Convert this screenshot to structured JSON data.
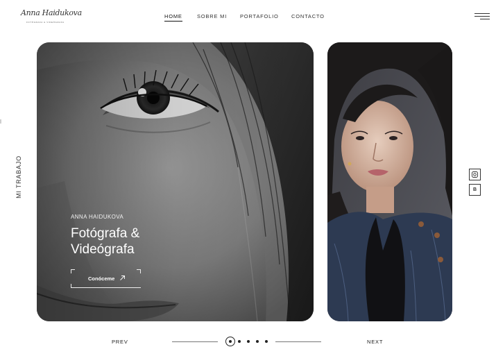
{
  "header": {
    "logo_script": "Anna Haidukova",
    "logo_sub": "FOTÓGRAFA & VIDEÓGRAFA"
  },
  "nav": {
    "items": [
      {
        "label": "HOME",
        "active": true
      },
      {
        "label": "SOBRE MI",
        "active": false
      },
      {
        "label": "PORTAFOLIO",
        "active": false
      },
      {
        "label": "CONTACTO",
        "active": false
      }
    ]
  },
  "side": {
    "label": "MI TRABAJO"
  },
  "hero": {
    "eyebrow": "ANNA HAIDUKOVA",
    "title_line1": "Fotógrafa &",
    "title_line2": "Videógrafa",
    "button_label": "Conóceme",
    "button_icon": "arrow-up-right-icon"
  },
  "social": {
    "instagram_icon": "instagram-icon",
    "behance_text": "B"
  },
  "pager": {
    "prev": "PREV",
    "next": "NEXT",
    "total": 5,
    "active_index": 0
  },
  "colors": {
    "text": "#222222",
    "background": "#ffffff",
    "hero_bg": "#6a6a6a",
    "card_bg": "#4a4a4f"
  }
}
